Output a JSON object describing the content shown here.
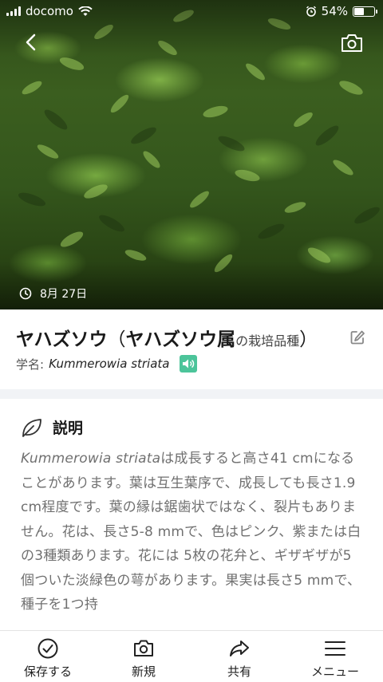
{
  "status_bar": {
    "carrier": "docomo",
    "battery_percent": "54%",
    "battery_level": 0.54
  },
  "hero": {
    "date": "8月 27日"
  },
  "plant": {
    "name": "ヤハズソウ",
    "genus": "ヤハズソウ属",
    "genus_suffix": "の栽培品種",
    "paren_open": "（",
    "paren_close": "）",
    "scientific_label": "学名: ",
    "scientific_name": "Kummerowia striata"
  },
  "description": {
    "heading": "説明",
    "body_sci": "Kummerowia striata",
    "body_text": "は成長すると高さ41 cmになることがあります。葉は互生葉序で、成長しても長さ1.9 cm程度です。葉の縁は鋸歯状ではなく、裂片もありません。花は、長さ5-8 mmで、色はピンク、紫または白の3種類あります。花には 5枚の花弁と、ギザギザが5個ついた淡緑色の萼があります。果実は長さ5 mmで、種子を1つ持"
  },
  "bottom_nav": {
    "save": "保存する",
    "new": "新規",
    "share": "共有",
    "menu": "メニュー"
  },
  "colors": {
    "accent_speaker": "#4cc49a",
    "divider": "#f1f3f6",
    "body_text": "#707070"
  }
}
